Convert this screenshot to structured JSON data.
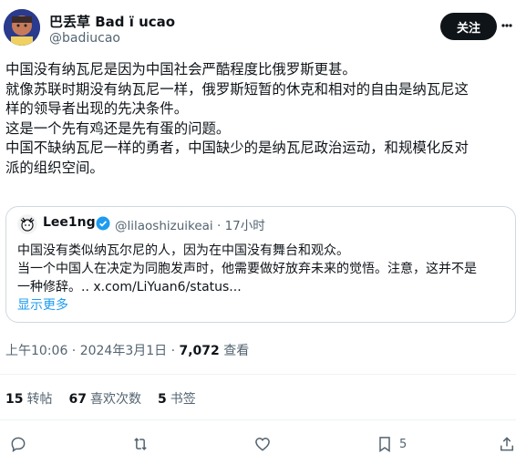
{
  "author": {
    "name": "巴丢草 Bad ï ucao",
    "handle": "@badiucao"
  },
  "follow_label": "关注",
  "tweet_lines": [
    "中国没有纳瓦尼是因为中国社会严酷程度比俄罗斯更甚。",
    "就像苏联时期没有纳瓦尼一样，俄罗斯短暂的休克和相对的自由是纳瓦尼这",
    "样的领导者出现的先决条件。",
    "这是一个先有鸡还是先有蛋的问题。",
    "中国不缺纳瓦尼一样的勇者，中国缺少的是纳瓦尼政治运动，和规模化反对",
    "派的组织空间。"
  ],
  "quoted": {
    "name": "Lee1ng",
    "handle": "@lilaoshizuikeai",
    "time": "· 17小时",
    "lines": [
      "中国没有类似纳瓦尔尼的人，因为在中国没有舞台和观众。",
      "当一个中国人在决定为同胞发声时，他需要做好放弃未来的觉悟。注意，这并不是",
      "一种修辞。.. x.com/LiYuan6/status..."
    ],
    "show_more": "显示更多"
  },
  "timestamp": {
    "time": "上午10:06 · 2024年3月1日 · ",
    "views_count": "7,072",
    "views_label": " 查看"
  },
  "stats": {
    "retweets_count": "15",
    "retweets_label": "转帖",
    "likes_count": "67",
    "likes_label": "喜欢次数",
    "bookmarks_count": "5",
    "bookmarks_label": "书签"
  },
  "actions": {
    "bookmark_count": "5"
  },
  "colors": {
    "accent": "#1d9bf0",
    "text": "#0f1419",
    "secondary": "#536471"
  }
}
